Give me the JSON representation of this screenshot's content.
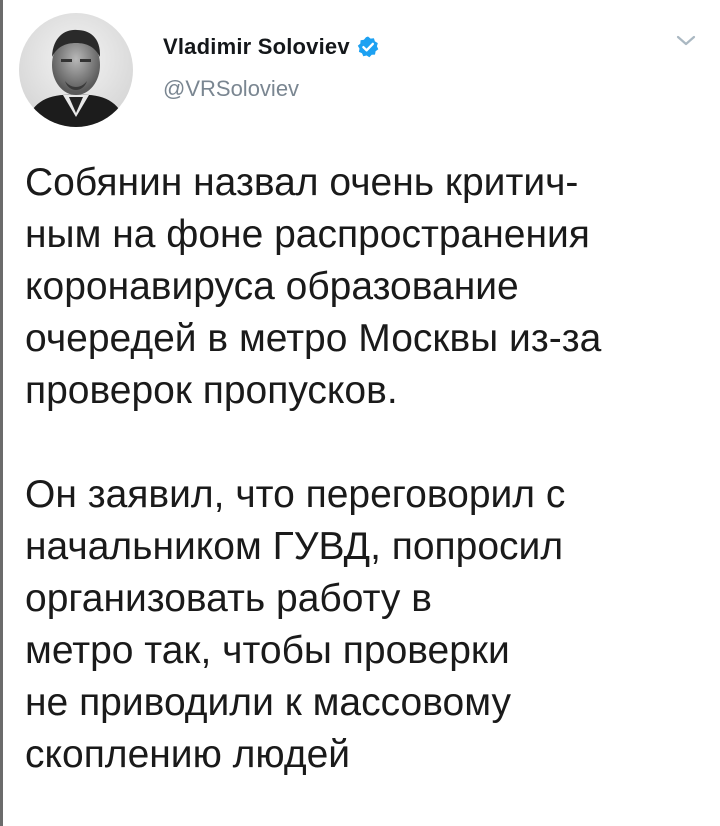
{
  "tweet": {
    "author": {
      "display_name": "Vladimir Soloviev",
      "handle": "@VRSoloviev",
      "verified": true
    },
    "paragraphs": [
      [
        "Собянин назвал очень критич-",
        "ным на фоне распространения",
        "коронавируса образование",
        "очередей в метро Москвы из-за",
        "проверок пропусков."
      ],
      [
        "Он заявил, что переговорил с",
        "начальником ГУВД, попросил",
        "организовать работу в",
        "метро так, чтобы проверки",
        "не приводили к массовому",
        "скоплению людей"
      ]
    ]
  },
  "icons": {
    "verified": "verified-badge-icon",
    "more": "chevron-down-icon"
  },
  "colors": {
    "verified_blue": "#1da1f2",
    "handle_gray": "#7a8691",
    "text": "#1a1a1a"
  }
}
